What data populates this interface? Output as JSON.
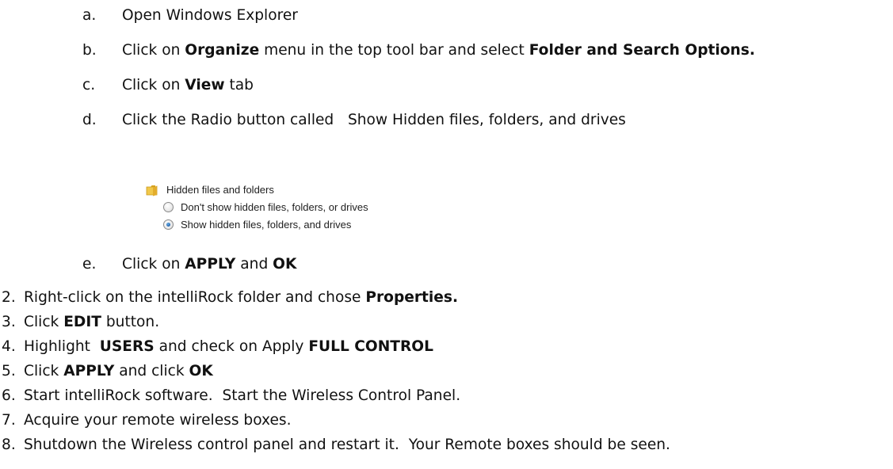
{
  "steps": {
    "a": {
      "marker": "a.",
      "text": "Open Windows Explorer"
    },
    "b": {
      "marker": "b.",
      "pre": "Click on ",
      "bold1": "Organize",
      "mid": " menu in the top tool bar and select ",
      "bold2": "Folder and Search Options."
    },
    "c": {
      "marker": "c.",
      "pre": "Click on ",
      "bold1": "View",
      "post": " tab"
    },
    "d": {
      "marker": "d.",
      "text": "Click the Radio button called   Show Hidden files, folders, and drives"
    },
    "e": {
      "marker": "e.",
      "pre": "Click on ",
      "bold1": "APPLY",
      "mid": " and ",
      "bold2": "OK"
    },
    "s2": {
      "marker": "2.",
      "pre": "Right-click on the intelliRock folder and chose ",
      "bold1": "Properties."
    },
    "s3": {
      "marker": "3.",
      "pre": "Click ",
      "bold1": "EDIT",
      "post": " button."
    },
    "s4": {
      "marker": "4.",
      "pre": "Highlight  ",
      "bold1": "USERS",
      "mid": " and check on Apply ",
      "bold2": "FULL CONTROL"
    },
    "s5": {
      "marker": "5.",
      "pre": "Click ",
      "bold1": "APPLY",
      "mid": " and click ",
      "bold2": "OK"
    },
    "s6": {
      "marker": "6.",
      "text": "Start intelliRock software.  Start the Wireless Control Panel."
    },
    "s7": {
      "marker": "7.",
      "text": "Acquire your remote wireless boxes."
    },
    "s8": {
      "marker": "8.",
      "text": "Shutdown the Wireless control panel and restart it.  Your Remote boxes should be seen."
    }
  },
  "screenshot": {
    "group_label": "Hidden files and folders",
    "option_dont_show": "Don't show hidden files, folders, or drives",
    "option_show": "Show hidden files, folders, and drives",
    "selected_option": "Show hidden files, folders, and drives",
    "icon": "folder-icon"
  },
  "colors": {
    "text": "#111111",
    "folder": "#e8b93a",
    "radio_selected": "#1f5fa8"
  }
}
